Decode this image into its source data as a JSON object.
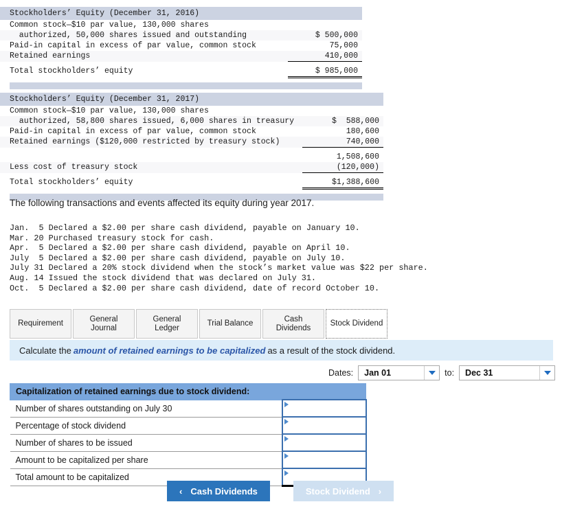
{
  "equity_2016": {
    "title": "Stockholders’ Equity (December 31, 2016)",
    "rows": [
      {
        "label": "Common stock—$10 par value, 130,000 shares",
        "amount": ""
      },
      {
        "label": "  authorized, 50,000 shares issued and outstanding",
        "amount": "$ 500,000"
      },
      {
        "label": "Paid-in capital in excess of par value, common stock",
        "amount": "75,000"
      },
      {
        "label": "Retained earnings",
        "amount": "410,000"
      },
      {
        "label": "Total stockholders’ equity",
        "amount": "$ 985,000"
      }
    ]
  },
  "equity_2017": {
    "title": "Stockholders’ Equity (December 31, 2017)",
    "rows": [
      {
        "label": "Common stock—$10 par value, 130,000 shares",
        "amount": ""
      },
      {
        "label": "  authorized, 58,800 shares issued, 6,000 shares in treasury",
        "amount": "$  588,000"
      },
      {
        "label": "Paid-in capital in excess of par value, common stock",
        "amount": "180,600"
      },
      {
        "label": "Retained earnings ($120,000 restricted by treasury stock)",
        "amount": "740,000"
      },
      {
        "label": "",
        "amount": "1,508,600"
      },
      {
        "label": "Less cost of treasury stock",
        "amount": "(120,000)"
      },
      {
        "label": "Total stockholders’ equity",
        "amount": "$1,388,600"
      }
    ]
  },
  "narrative": "The following transactions and events affected its equity during year 2017.",
  "transactions": "Jan.  5 Declared a $2.00 per share cash dividend, payable on January 10.\nMar. 20 Purchased treasury stock for cash.\nApr.  5 Declared a $2.00 per share cash dividend, payable on April 10.\nJuly  5 Declared a $2.00 per share cash dividend, payable on July 10.\nJuly 31 Declared a 20% stock dividend when the stock’s market value was $22 per share.\nAug. 14 Issued the stock dividend that was declared on July 31.\nOct.  5 Declared a $2.00 per share cash dividend, date of record October 10.",
  "tabs": [
    {
      "label": "Requirement",
      "active": false
    },
    {
      "label": "General\nJournal",
      "active": false
    },
    {
      "label": "General\nLedger",
      "active": false
    },
    {
      "label": "Trial Balance",
      "active": false
    },
    {
      "label": "Cash\nDividends",
      "active": false
    },
    {
      "label": "Stock Dividend",
      "active": true
    }
  ],
  "instruction": {
    "before": "Calculate the",
    "emphasis": "amount of retained earnings to be capitalized",
    "after": "as a result of the stock dividend."
  },
  "dates": {
    "label": "Dates:",
    "from_value": "Jan 01",
    "to_label": "to:",
    "to_value": "Dec 31"
  },
  "cap_table": {
    "header": "Capitalization of retained earnings due to stock dividend:",
    "rows": [
      {
        "label": "Number of shares outstanding on July 30",
        "value": ""
      },
      {
        "label": "Percentage of stock dividend",
        "value": ""
      },
      {
        "label": "Number of shares to be issued",
        "value": ""
      },
      {
        "label": "Amount to be capitalized per share",
        "value": ""
      },
      {
        "label": "Total amount to be capitalized",
        "value": ""
      }
    ]
  },
  "nav": {
    "prev_chevron": "‹",
    "prev_label": "Cash Dividends",
    "next_label": "Stock Dividend",
    "next_chevron": "›"
  },
  "colors": {
    "table_title_bg": "#ccd3e2",
    "instruction_bg": "#ddedf9",
    "cap_header_bg": "#79a6dc",
    "accent_blue": "#2c75bb",
    "emphasis_blue": "#2b56a8",
    "input_border": "#3b6fae",
    "disabled_btn": "#cfe0f1"
  }
}
